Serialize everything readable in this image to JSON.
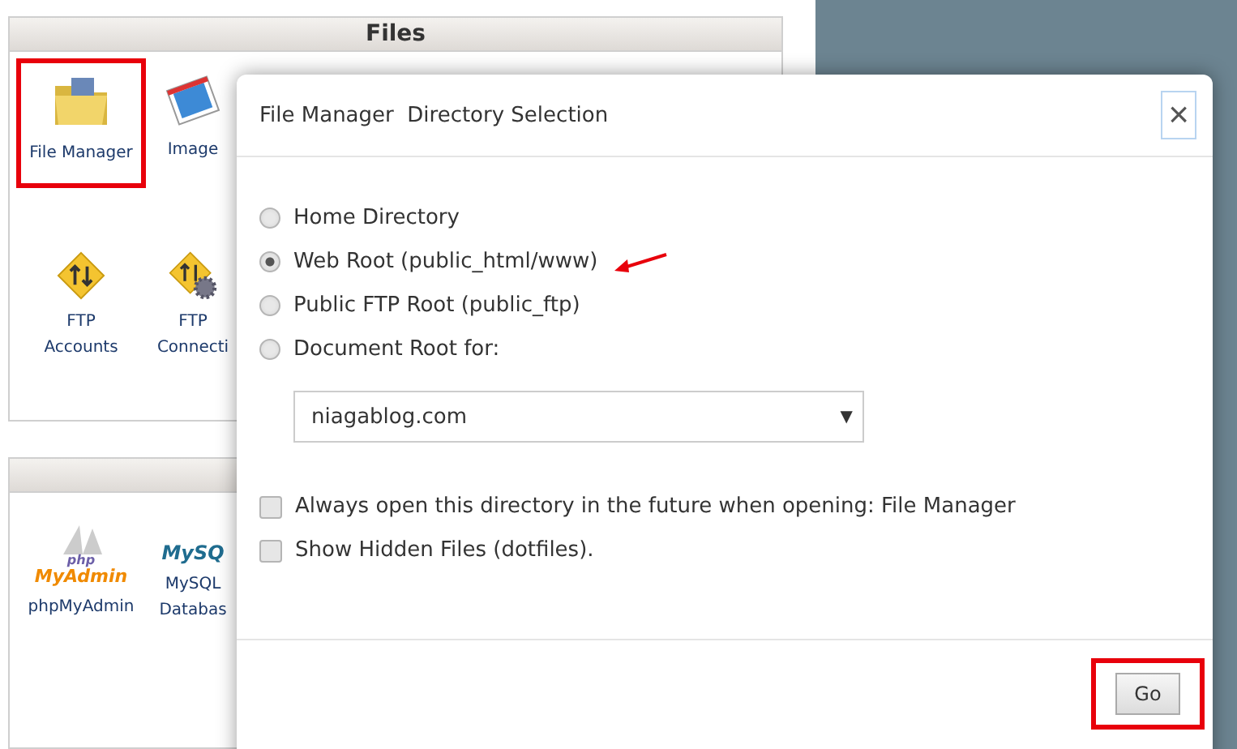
{
  "files_panel": {
    "title": "Files",
    "tiles": [
      {
        "kind": "folder",
        "label": "File Manager",
        "highlighted": true
      },
      {
        "kind": "image",
        "label": "Image",
        "highlighted": false
      },
      {
        "kind": "ftp",
        "label": "FTP Accounts",
        "highlighted": false
      },
      {
        "kind": "ftp-gear",
        "label": "FTP Connecti",
        "highlighted": false
      }
    ]
  },
  "databases_panel": {
    "tiles": [
      {
        "kind": "phpmyadmin",
        "logo": [
          "php",
          "MyAdmin"
        ],
        "label": "phpMyAdmin",
        "highlighted": false
      },
      {
        "kind": "mysql",
        "logo": [
          "MySQ"
        ],
        "label": "MySQL Databas",
        "highlighted": false
      }
    ]
  },
  "dialog": {
    "title": "File Manager  Directory Selection",
    "close": "×",
    "options": [
      {
        "label": "Home Directory",
        "selected": false,
        "arrow": false
      },
      {
        "label": "Web Root (public_html/www)",
        "selected": true,
        "arrow": true
      },
      {
        "label": "Public FTP Root (public_ftp)",
        "selected": false,
        "arrow": false
      },
      {
        "label": "Document Root for:",
        "selected": false,
        "arrow": false
      }
    ],
    "domain_select": {
      "value": "niagablog.com",
      "caret": "▼"
    },
    "checkboxes": [
      {
        "label": "Always open this directory in the future when opening: File Manager",
        "checked": false
      },
      {
        "label": "Show Hidden Files (dotfiles).",
        "checked": false
      }
    ],
    "go_button": {
      "label": "Go",
      "highlighted": true
    }
  }
}
